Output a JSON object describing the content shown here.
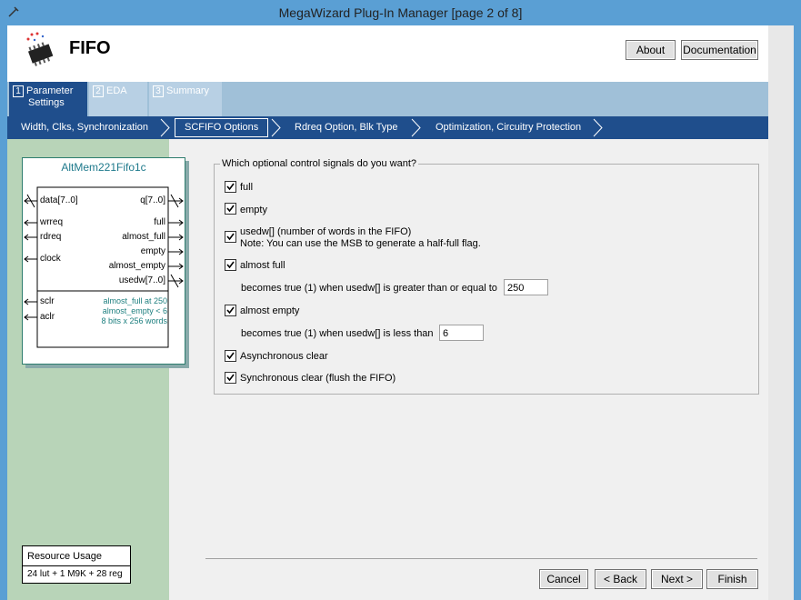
{
  "window": {
    "title": "MegaWizard Plug-In Manager [page 2 of 8]"
  },
  "header": {
    "name": "FIFO",
    "about_label": "About",
    "documentation_label": "Documentation"
  },
  "tabs": [
    {
      "num": "1",
      "label_line1": "Parameter",
      "label_line2": "Settings"
    },
    {
      "num": "2",
      "label_line1": "EDA",
      "label_line2": ""
    },
    {
      "num": "3",
      "label_line1": "Summary",
      "label_line2": ""
    }
  ],
  "subnav": [
    {
      "label": "Width, Clks, Synchronization"
    },
    {
      "label": "SCFIFO Options"
    },
    {
      "label": "Rdreq Option, Blk Type"
    },
    {
      "label": "Optimization, Circuitry Protection"
    }
  ],
  "symbol": {
    "title": "AltMem221Fifo1c",
    "inputs": [
      "data[7..0]",
      "wrreq",
      "rdreq",
      "clock",
      "sclr",
      "aclr"
    ],
    "outputs": [
      "q[7..0]",
      "full",
      "almost_full",
      "empty",
      "almost_empty",
      "usedw[7..0]"
    ],
    "notes": [
      "almost_full at 250",
      "almost_empty < 6",
      "8 bits x 256 words"
    ]
  },
  "resources": {
    "title": "Resource Usage",
    "value": "24 lut + 1 M9K + 28 reg"
  },
  "options": {
    "group_label": "Which optional control signals do you want?",
    "full": {
      "label": "full",
      "checked": true
    },
    "empty": {
      "label": "empty",
      "checked": true
    },
    "usedw": {
      "label": "usedw[]  (number of words in the FIFO)",
      "note": "Note: You can use the MSB to generate a half-full flag.",
      "checked": true
    },
    "almost_full": {
      "label": "almost full",
      "checked": true,
      "threshold_text": "becomes true (1) when usedw[] is greater than or equal to",
      "value": "250"
    },
    "almost_empty": {
      "label": "almost empty",
      "checked": true,
      "threshold_text": "becomes true (1) when usedw[] is less than",
      "value": "6"
    },
    "async_clear": {
      "label": "Asynchronous clear",
      "checked": true
    },
    "sync_clear": {
      "label": "Synchronous clear (flush the FIFO)",
      "checked": true
    }
  },
  "footer": {
    "cancel": "Cancel",
    "back": "< Back",
    "next": "Next >",
    "finish": "Finish"
  },
  "colors": {
    "titlebar": "#5a9fd4",
    "subnav": "#1f4e8c",
    "left_panel": "#b8d4b8",
    "tabs_bg": "#a0c0d8"
  }
}
